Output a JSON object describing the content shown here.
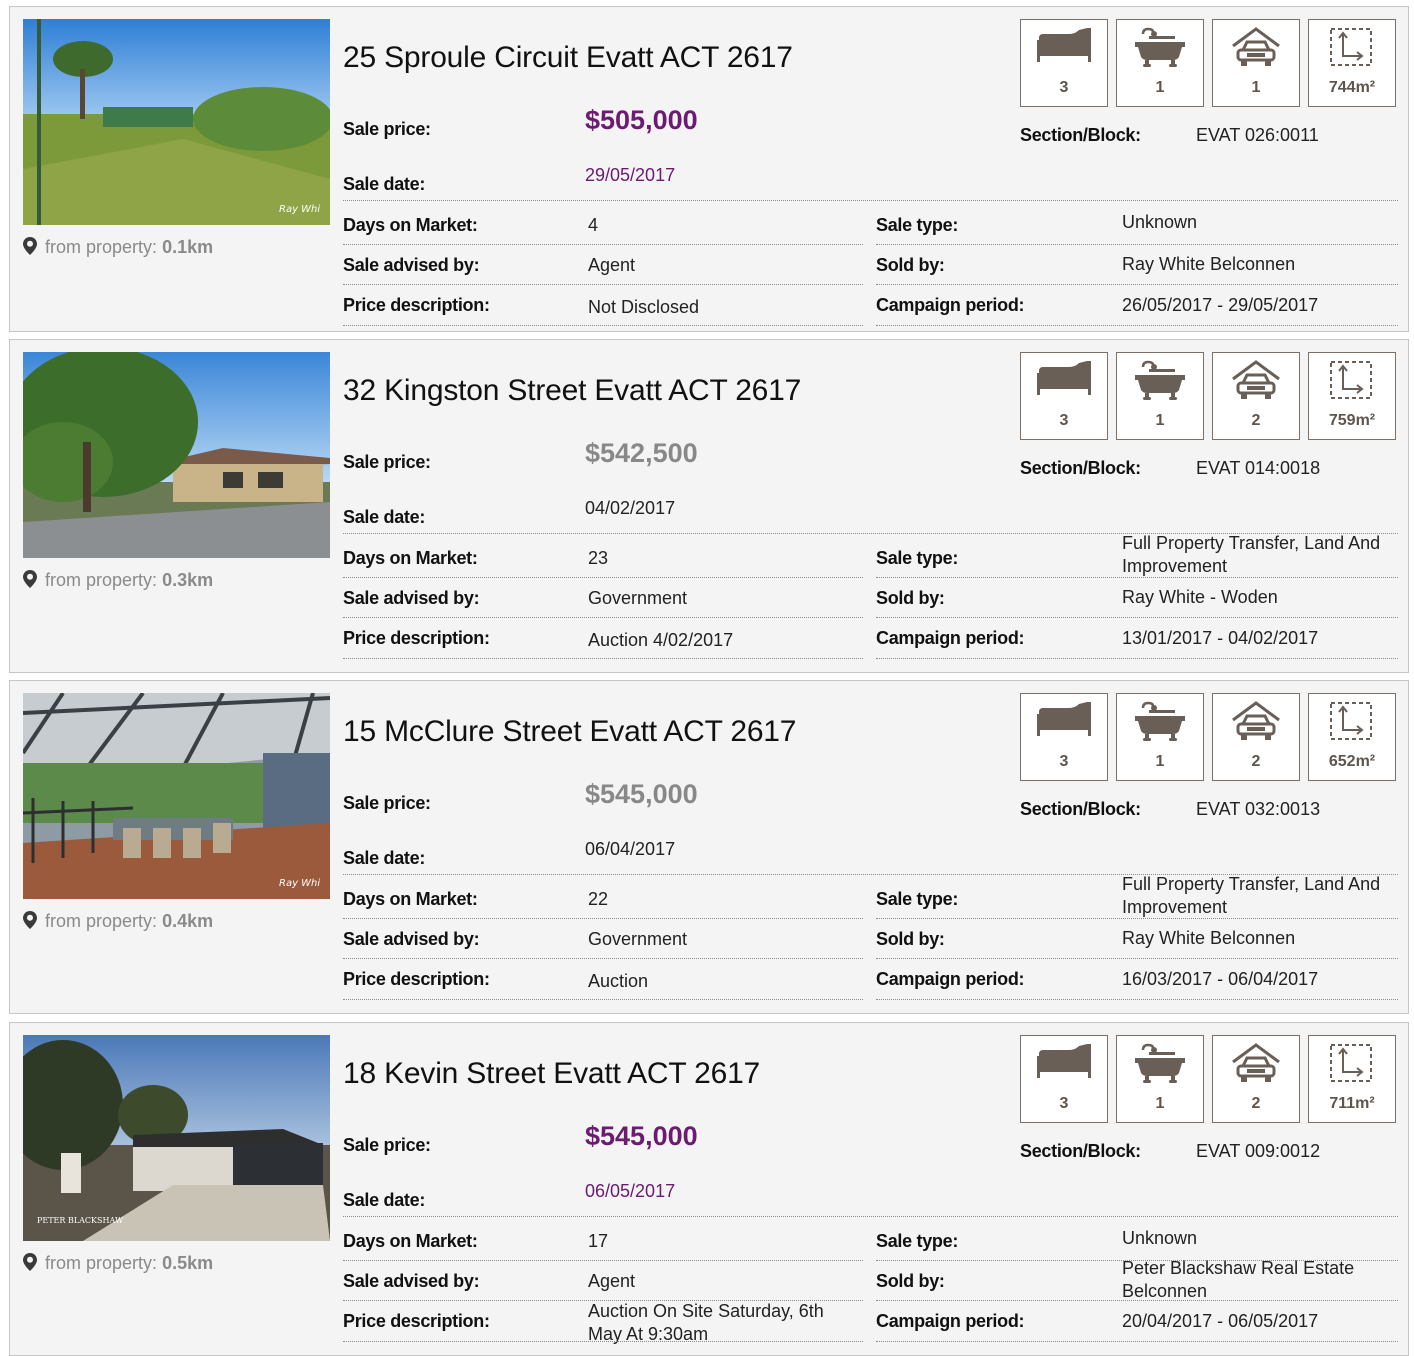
{
  "colors": {
    "accent_price": "#6c1a72",
    "muted_price": "#888888",
    "icon": "#6a5f56"
  },
  "labels": {
    "sale_price": "Sale price:",
    "sale_date": "Sale date:",
    "days_on_market": "Days on Market:",
    "sale_advised_by": "Sale advised by:",
    "price_description": "Price description:",
    "section_block": "Section/Block:",
    "sale_type": "Sale type:",
    "sold_by": "Sold by:",
    "campaign_period": "Campaign period:",
    "from_property": "from property:",
    "area_unit": "m²"
  },
  "listings": [
    {
      "address": "25 Sproule Circuit Evatt ACT 2617",
      "sale_price": "$505,000",
      "price_highlighted": true,
      "sale_date": "29/05/2017",
      "days_on_market": "4",
      "sale_advised_by": "Agent",
      "price_description": "Not Disclosed",
      "section_block": "EVAT 026:0011",
      "sale_type": "Unknown",
      "sold_by": "Ray White Belconnen",
      "campaign_period": "26/05/2017 - 29/05/2017",
      "distance": "0.1km",
      "beds": "3",
      "baths": "1",
      "cars": "1",
      "land": "744",
      "photo_icon": "house-front-lawn-photo"
    },
    {
      "address": "32 Kingston Street Evatt ACT 2617",
      "sale_price": "$542,500",
      "price_highlighted": false,
      "sale_date": "04/02/2017",
      "days_on_market": "23",
      "sale_advised_by": "Government",
      "price_description": "Auction 4/02/2017",
      "section_block": "EVAT 014:0018",
      "sale_type": "Full Property Transfer, Land And Improvement",
      "sold_by": "Ray White - Woden",
      "campaign_period": "13/01/2017 - 04/02/2017",
      "distance": "0.3km",
      "beds": "3",
      "baths": "1",
      "cars": "2",
      "land": "759",
      "photo_icon": "brick-house-tree-photo"
    },
    {
      "address": "15 McClure Street Evatt ACT 2617",
      "sale_price": "$545,000",
      "price_highlighted": false,
      "sale_date": "06/04/2017",
      "days_on_market": "22",
      "sale_advised_by": "Government",
      "price_description": "Auction",
      "section_block": "EVAT 032:0013",
      "sale_type": "Full Property Transfer, Land And Improvement",
      "sold_by": "Ray White Belconnen",
      "campaign_period": "16/03/2017 - 06/04/2017",
      "distance": "0.4km",
      "beds": "3",
      "baths": "1",
      "cars": "2",
      "land": "652",
      "photo_icon": "pergola-deck-photo"
    },
    {
      "address": "18 Kevin Street Evatt ACT 2617",
      "sale_price": "$545,000",
      "price_highlighted": true,
      "sale_date": "06/05/2017",
      "days_on_market": "17",
      "sale_advised_by": "Agent",
      "price_description": "Auction On Site Saturday, 6th May At 9:30am",
      "section_block": "EVAT 009:0012",
      "sale_type": "Unknown",
      "sold_by": "Peter Blackshaw Real Estate Belconnen",
      "campaign_period": "20/04/2017 - 06/05/2017",
      "distance": "0.5km",
      "beds": "3",
      "baths": "1",
      "cars": "2",
      "land": "711",
      "photo_icon": "house-garage-driveway-photo"
    }
  ]
}
